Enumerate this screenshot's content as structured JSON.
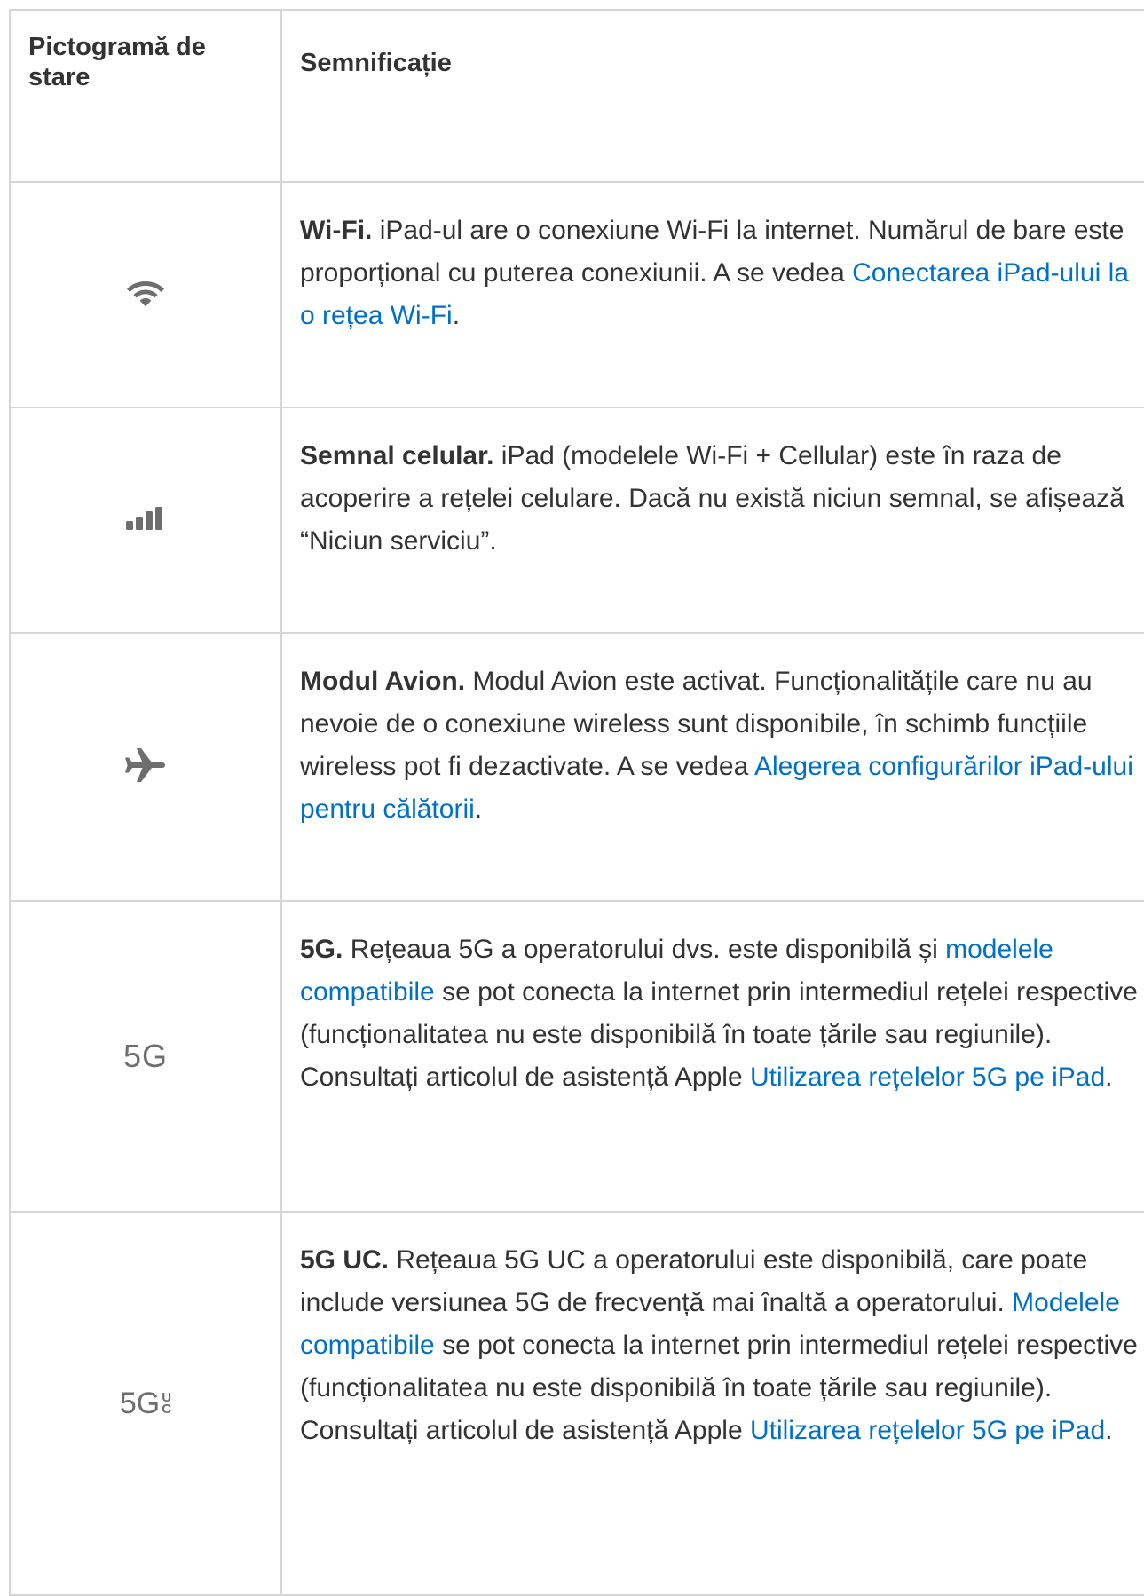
{
  "table": {
    "header": {
      "col_icon": "Pictogramă de stare",
      "col_meaning": "Semnificație"
    },
    "rows": [
      {
        "icon": "wifi-icon",
        "title": "Wi-Fi.",
        "text_1": " iPad-ul are o conexiune Wi-Fi la internet. Numărul de bare este proporțional cu puterea conexiunii. A se vedea ",
        "link_1": "Conectarea iPad-ului la o rețea Wi-Fi",
        "text_2": "."
      },
      {
        "icon": "cellular-signal-icon",
        "title": "Semnal celular.",
        "text_1": " iPad (modelele Wi-Fi + Cellular) este în raza de acoperire a rețelei celulare. Dacă nu există niciun semnal, se afișează “Niciun serviciu”."
      },
      {
        "icon": "airplane-icon",
        "title": "Modul Avion.",
        "text_1": " Modul Avion este activat. Funcționalitățile care nu au nevoie de o conexiune wireless sunt disponibile, în schimb funcțiile wireless pot fi dezactivate. A se vedea ",
        "link_1": "Alegerea configurărilor iPad-ului pentru călătorii",
        "text_2": "."
      },
      {
        "icon": "5g-icon",
        "icon_text": "5G",
        "title": "5G.",
        "text_1": " Rețeaua 5G a operatorului dvs. este disponibilă și ",
        "link_1": "modelele compatibile",
        "text_2": " se pot conecta la internet prin intermediul rețelei respective (funcționalitatea nu este disponibilă în toate țările sau regiunile). Consultați articolul de asistență Apple ",
        "link_2": "Utilizarea rețelelor 5G pe iPad",
        "text_3": "."
      },
      {
        "icon": "5g-uc-icon",
        "icon_text": "5G",
        "icon_sub_top": "U",
        "icon_sub_bottom": "C",
        "title": "5G UC.",
        "text_1": " Rețeaua 5G UC a operatorului este disponibilă, care poate include versiunea 5G de frecvență mai înaltă a operatorului. ",
        "link_1": "Modelele compatibile",
        "text_2": " se pot conecta la internet prin intermediul rețelei respective (funcționalitatea nu este disponibilă în toate țările sau regiunile). Consultați articolul de asistență Apple ",
        "link_2": "Utilizarea rețelelor 5G pe iPad",
        "text_3": "."
      }
    ]
  },
  "colors": {
    "text": "#333333",
    "icon": "#6e6e6e",
    "link": "#0070c9",
    "border": "#d6d6d6"
  }
}
